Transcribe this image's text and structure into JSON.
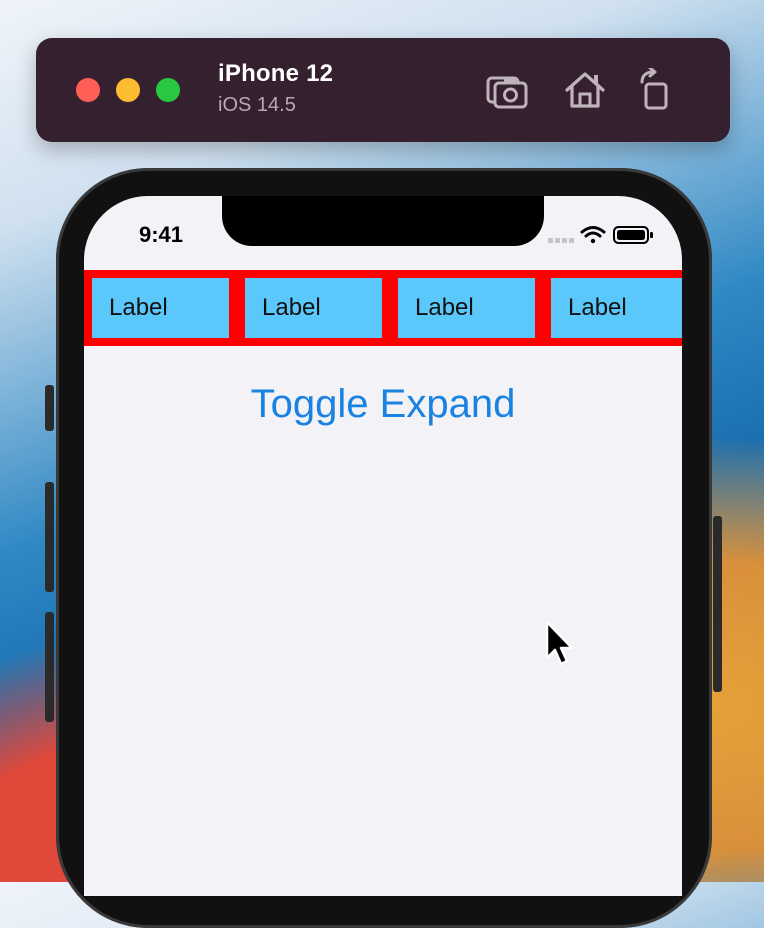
{
  "simulator": {
    "device_name": "iPhone 12",
    "os_version": "iOS 14.5",
    "toolbar_icons": [
      "screenshot-icon",
      "home-icon",
      "rotate-icon"
    ],
    "window_controls": [
      "close",
      "minimize",
      "zoom"
    ]
  },
  "status_bar": {
    "time": "9:41",
    "icons": [
      "signal-icon",
      "wifi-icon",
      "battery-icon"
    ]
  },
  "app": {
    "labels": [
      "Label",
      "Label",
      "Label",
      "Label"
    ],
    "toggle_button": "Toggle Expand",
    "colors": {
      "label_background": "#5ac8fa",
      "label_border": "#ff0000",
      "button_tint": "#1a82e0",
      "screen_background": "#f2f2f7"
    }
  }
}
